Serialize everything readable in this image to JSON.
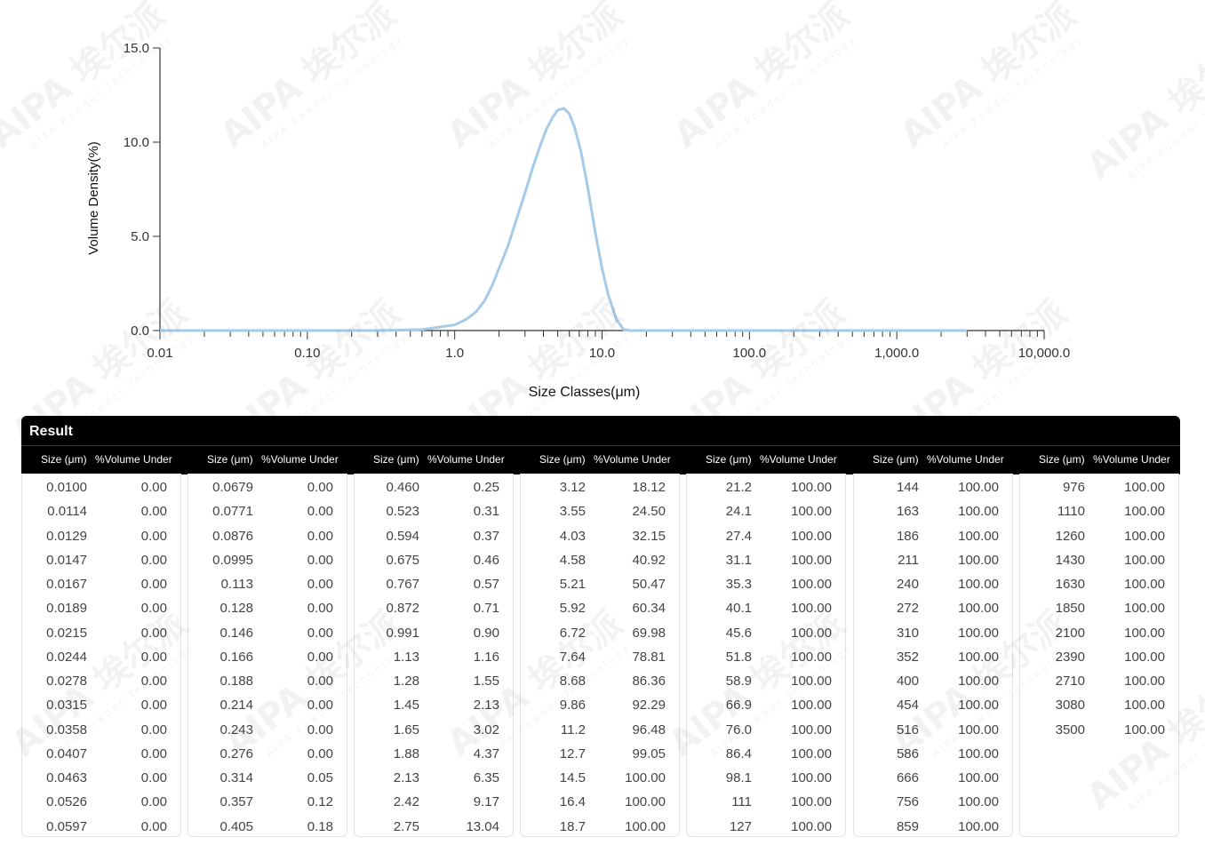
{
  "chart_data": {
    "type": "line",
    "xscale": "log",
    "xlim": [
      0.01,
      10000
    ],
    "ylim": [
      0,
      15
    ],
    "xlabel": "Size Classes(μm)",
    "ylabel": "Volume Density(%)",
    "x_tick_labels": [
      "0.01",
      "0.10",
      "1.0",
      "10.0",
      "100.0",
      "1,000.0",
      "10,000.0"
    ],
    "y_tick_labels": [
      "0.0",
      "5.0",
      "10.0",
      "15.0"
    ],
    "line_color": "#a6cbe8",
    "series": [
      {
        "x": [
          0.01,
          0.1,
          0.3,
          0.6,
          1.0,
          1.2,
          1.4,
          1.6,
          1.8,
          2.0,
          2.3,
          2.6,
          3.0,
          3.4,
          3.8,
          4.2,
          4.6,
          5.0,
          5.5,
          6.0,
          6.5,
          7.2,
          8.0,
          9.0,
          10.0,
          11.0,
          12.5,
          14.0,
          15.5,
          17.0,
          30,
          100,
          1000,
          3000
        ],
        "y": [
          0.0,
          0.0,
          0.0,
          0.05,
          0.3,
          0.6,
          1.0,
          1.6,
          2.4,
          3.3,
          4.5,
          5.8,
          7.3,
          8.7,
          9.8,
          10.7,
          11.3,
          11.7,
          11.8,
          11.5,
          10.8,
          9.5,
          7.6,
          5.2,
          3.3,
          1.9,
          0.6,
          0.05,
          0.0,
          0.0,
          0.0,
          0.0,
          0.0,
          0.0
        ]
      }
    ]
  },
  "watermark": {
    "text_cn": "埃尔派",
    "text_en": "AIPA",
    "subtext": "AIPA Powder Technology"
  },
  "table": {
    "title": "Result",
    "size_header": "Size (μm)",
    "volume_header": "%Volume Under",
    "columns": [
      {
        "size": [
          "0.0100",
          "0.0114",
          "0.0129",
          "0.0147",
          "0.0167",
          "0.0189",
          "0.0215",
          "0.0244",
          "0.0278",
          "0.0315",
          "0.0358",
          "0.0407",
          "0.0463",
          "0.0526",
          "0.0597"
        ],
        "volume": [
          "0.00",
          "0.00",
          "0.00",
          "0.00",
          "0.00",
          "0.00",
          "0.00",
          "0.00",
          "0.00",
          "0.00",
          "0.00",
          "0.00",
          "0.00",
          "0.00",
          "0.00"
        ]
      },
      {
        "size": [
          "0.0679",
          "0.0771",
          "0.0876",
          "0.0995",
          "0.113",
          "0.128",
          "0.146",
          "0.166",
          "0.188",
          "0.214",
          "0.243",
          "0.276",
          "0.314",
          "0.357",
          "0.405"
        ],
        "volume": [
          "0.00",
          "0.00",
          "0.00",
          "0.00",
          "0.00",
          "0.00",
          "0.00",
          "0.00",
          "0.00",
          "0.00",
          "0.00",
          "0.00",
          "0.05",
          "0.12",
          "0.18"
        ]
      },
      {
        "size": [
          "0.460",
          "0.523",
          "0.594",
          "0.675",
          "0.767",
          "0.872",
          "0.991",
          "1.13",
          "1.28",
          "1.45",
          "1.65",
          "1.88",
          "2.13",
          "2.42",
          "2.75"
        ],
        "volume": [
          "0.25",
          "0.31",
          "0.37",
          "0.46",
          "0.57",
          "0.71",
          "0.90",
          "1.16",
          "1.55",
          "2.13",
          "3.02",
          "4.37",
          "6.35",
          "9.17",
          "13.04"
        ]
      },
      {
        "size": [
          "3.12",
          "3.55",
          "4.03",
          "4.58",
          "5.21",
          "5.92",
          "6.72",
          "7.64",
          "8.68",
          "9.86",
          "11.2",
          "12.7",
          "14.5",
          "16.4",
          "18.7"
        ],
        "volume": [
          "18.12",
          "24.50",
          "32.15",
          "40.92",
          "50.47",
          "60.34",
          "69.98",
          "78.81",
          "86.36",
          "92.29",
          "96.48",
          "99.05",
          "100.00",
          "100.00",
          "100.00"
        ]
      },
      {
        "size": [
          "21.2",
          "24.1",
          "27.4",
          "31.1",
          "35.3",
          "40.1",
          "45.6",
          "51.8",
          "58.9",
          "66.9",
          "76.0",
          "86.4",
          "98.1",
          "111",
          "127"
        ],
        "volume": [
          "100.00",
          "100.00",
          "100.00",
          "100.00",
          "100.00",
          "100.00",
          "100.00",
          "100.00",
          "100.00",
          "100.00",
          "100.00",
          "100.00",
          "100.00",
          "100.00",
          "100.00"
        ]
      },
      {
        "size": [
          "144",
          "163",
          "186",
          "211",
          "240",
          "272",
          "310",
          "352",
          "400",
          "454",
          "516",
          "586",
          "666",
          "756",
          "859"
        ],
        "volume": [
          "100.00",
          "100.00",
          "100.00",
          "100.00",
          "100.00",
          "100.00",
          "100.00",
          "100.00",
          "100.00",
          "100.00",
          "100.00",
          "100.00",
          "100.00",
          "100.00",
          "100.00"
        ]
      },
      {
        "size": [
          "976",
          "1110",
          "1260",
          "1430",
          "1630",
          "1850",
          "2100",
          "2390",
          "2710",
          "3080",
          "3500"
        ],
        "volume": [
          "100.00",
          "100.00",
          "100.00",
          "100.00",
          "100.00",
          "100.00",
          "100.00",
          "100.00",
          "100.00",
          "100.00",
          "100.00"
        ]
      }
    ]
  }
}
